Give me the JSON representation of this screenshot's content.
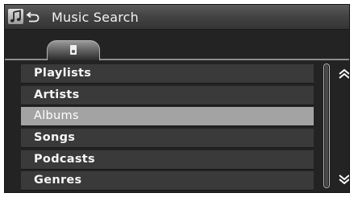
{
  "header": {
    "title": "Music Search",
    "icons": [
      "music-note-icon",
      "back-icon"
    ]
  },
  "tabs": [
    {
      "icon": "music-device-icon",
      "selected": true
    }
  ],
  "list": {
    "items": [
      {
        "label": "Playlists",
        "selected": false
      },
      {
        "label": "Artists",
        "selected": false
      },
      {
        "label": "Albums",
        "selected": true
      },
      {
        "label": "Songs",
        "selected": false
      },
      {
        "label": "Podcasts",
        "selected": false
      },
      {
        "label": "Genres",
        "selected": false
      }
    ]
  },
  "scroll": {
    "up_icon": "double-chevron-up-icon",
    "down_icon": "double-chevron-down-icon"
  },
  "colors": {
    "background": "#232323",
    "item": "#3a3a3a",
    "selected_item": "#a3a3a3",
    "text": "#f5f5f5"
  }
}
